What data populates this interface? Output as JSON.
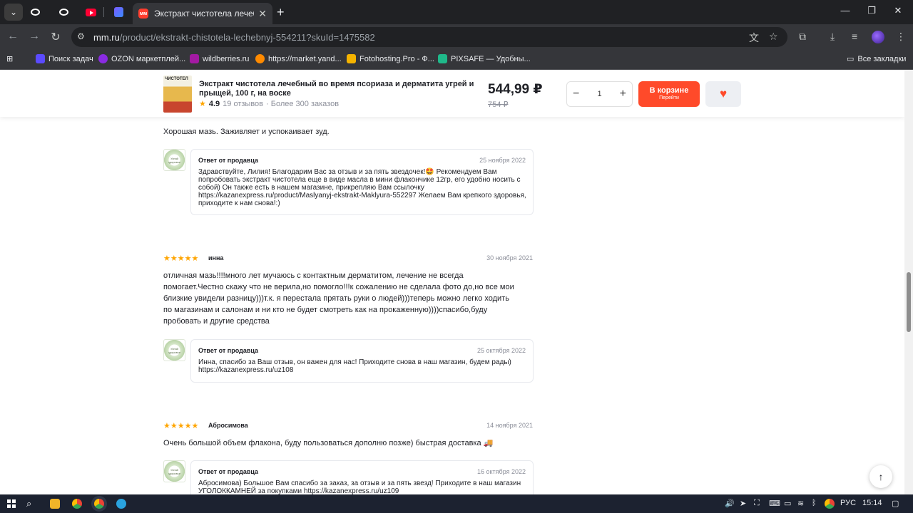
{
  "browser": {
    "active_tab_title": "Экстракт чистотела лечебный",
    "url_host": "mm.ru",
    "url_path": "/product/ekstrakt-chistotela-lechebnyj-554211?skuId=1475582",
    "bookmarks": [
      {
        "label": "Поиск задач",
        "color": "#5b4bff"
      },
      {
        "label": "OZON маркетплей...",
        "color": "#8a2be2"
      },
      {
        "label": "wildberries.ru",
        "color": "#a31aa3"
      },
      {
        "label": "https://market.yand...",
        "color": "#ffcc00"
      },
      {
        "label": "Fotohosting.Pro - Ф...",
        "color": "#f5b400"
      },
      {
        "label": "PIXSAFE — Удобны...",
        "color": "#1fb98a"
      }
    ],
    "all_bookmarks": "Все закладки"
  },
  "product": {
    "title": "Экстракт чистотела лечебный во время псориаза и дерматита угрей и прыщей, 100 г, на воске",
    "thumb_label": "ЧИСТОТЕЛ",
    "rating": "4.9",
    "reviews": "19 отзывов",
    "orders": "· Более 300 заказов",
    "price": "544,99 ₽",
    "old_price": "754 ₽",
    "qty": "1",
    "cart_label": "В корзине",
    "cart_sub": "Перейти"
  },
  "reviews": {
    "top_text": "Хорошая мазь. Заживляет и успокаивает зуд.",
    "seller_logo_text": "Узнай здоровье",
    "reply1": {
      "author": "Ответ от продавца",
      "date": "25 ноября 2022",
      "text": "Здравствуйте, Лилия! Благодарим Вас за отзыв и за пять звездочек!🤩 Рекомендуем Вам попробовать экстракт чистотела еще в виде масла в мини флакончике 12гр, его удобно носить с собой) Он также есть в нашем магазине, прикрепляю Вам ссылочку https://kazanexpress.ru/product/Maslyanyj-ekstrakt-Maklyura-552297 Желаем Вам крепкого здоровья, приходите к нам снова!:)"
    },
    "review2": {
      "stars": "★★★★★",
      "author": "инна",
      "date": "30 ноября 2021",
      "text": "отличная мазь!!!!много лет мучаюсь с контактным дерматитом, лечение не всегда помогает.Честно скажу что не верила,но помогло!!!к сожалению не сделала фото до,но все мои близкие увидели разницу)))т.к. я перестала прятать руки о людей)))теперь можно легко ходить по магазинам и салонам и ни кто не будет смотреть как на прокаженную))))спасибо,буду пробовать и другие средства"
    },
    "reply2": {
      "author": "Ответ от продавца",
      "date": "25 октября 2022",
      "text": "Инна, спасибо за Ваш отзыв, он важен для нас! Приходите снова в наш магазин, будем рады) https://kazanexpress.ru/uz108"
    },
    "review3": {
      "stars": "★★★★★",
      "author": "Абросимова",
      "date": "14 ноября 2021",
      "text": "Очень большой объем флакона, буду пользоваться дополню позже) быстрая доставка 🚚"
    },
    "reply3": {
      "author": "Ответ от продавца",
      "date": "16 октября 2022",
      "text": "Абросимова) Большое Вам спасибо за заказ, за отзыв и за пять звезд! Приходите в наш магазин УГОЛОККАМНЕЙ за покупками https://kazanexpress.ru/uz109"
    }
  },
  "taskbar": {
    "lang": "РУС",
    "time": "15:14"
  }
}
